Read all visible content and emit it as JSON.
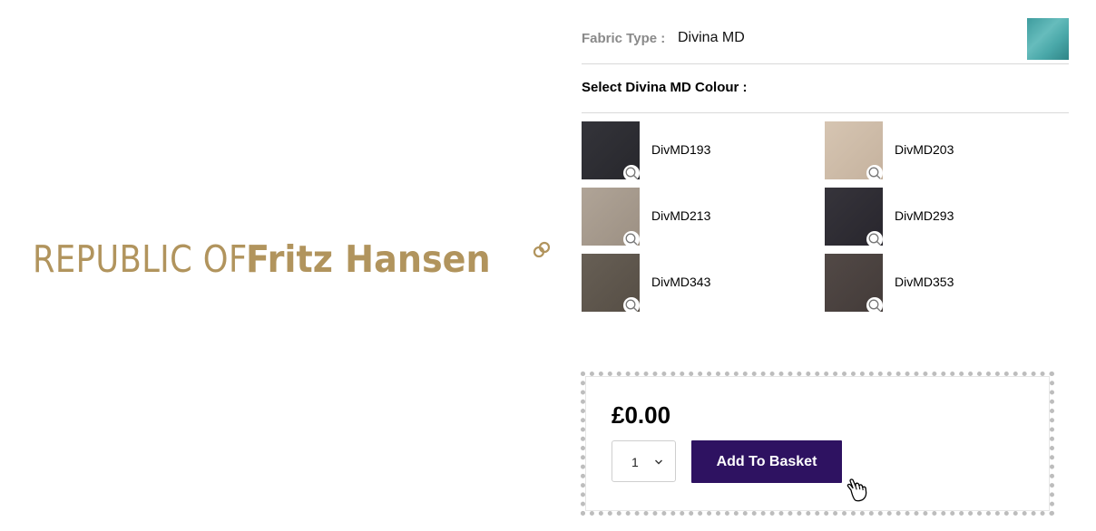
{
  "brand": {
    "logo_light": "REPUBLIC OF",
    "logo_bold": "Fritz Hansen",
    "color": "#b1945d"
  },
  "fabric": {
    "label": "Fabric Type :",
    "value": "Divina MD",
    "thumbnail_color": "#4aa8a9"
  },
  "colour_selector": {
    "heading": "Select Divina MD Colour :",
    "swatches": [
      {
        "name": "DivMD193",
        "color": "#2c2c31"
      },
      {
        "name": "DivMD203",
        "color": "#cdbba7"
      },
      {
        "name": "DivMD213",
        "color": "#a69a8c"
      },
      {
        "name": "DivMD293",
        "color": "#2e2c33"
      },
      {
        "name": "DivMD343",
        "color": "#5e564c"
      },
      {
        "name": "DivMD353",
        "color": "#4a4240"
      }
    ]
  },
  "purchase": {
    "price": "£0.00",
    "quantity": "1",
    "add_label": "Add To Basket",
    "button_color": "#2e1261"
  }
}
